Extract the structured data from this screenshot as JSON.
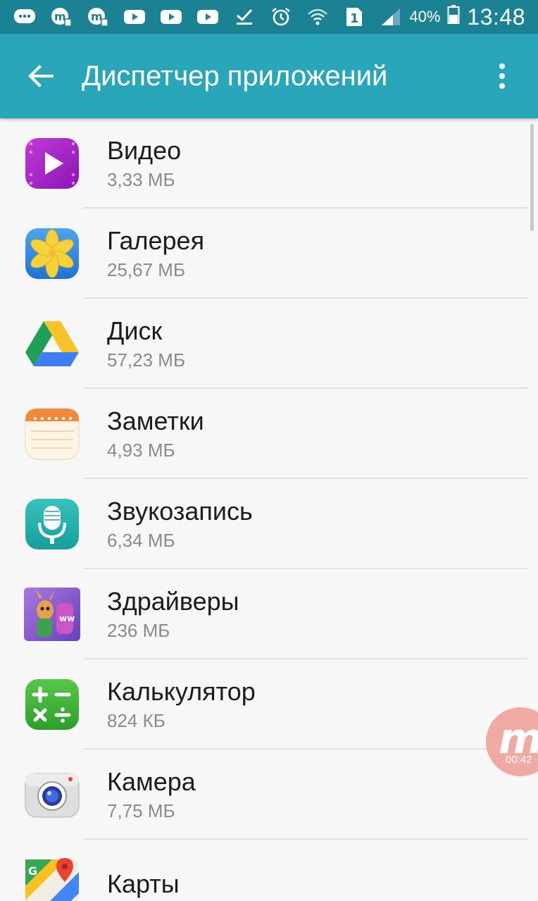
{
  "status_bar": {
    "icons": [
      "chat-bubble-icon",
      "app-m-icon",
      "app-m-icon",
      "youtube-icon",
      "youtube-icon",
      "youtube-icon",
      "download-done-icon",
      "alarm-icon",
      "wifi-icon",
      "sim-1-icon",
      "signal-icon"
    ],
    "battery_percent": "40%",
    "time": "13:48"
  },
  "app_bar": {
    "title": "Диспетчер приложений",
    "back_icon": "arrow-back-icon",
    "menu_icon": "more-vert-icon"
  },
  "apps": [
    {
      "name": "Видео",
      "size": "3,33 МБ",
      "icon": "video-app-icon"
    },
    {
      "name": "Галерея",
      "size": "25,67 МБ",
      "icon": "gallery-app-icon"
    },
    {
      "name": "Диск",
      "size": "57,23 МБ",
      "icon": "drive-app-icon"
    },
    {
      "name": "Заметки",
      "size": "4,93 МБ",
      "icon": "notes-app-icon"
    },
    {
      "name": "Звукозапись",
      "size": "6,34 МБ",
      "icon": "voice-recorder-app-icon"
    },
    {
      "name": "Здрайверы",
      "size": "236 МБ",
      "icon": "zdraivery-app-icon"
    },
    {
      "name": "Калькулятор",
      "size": "824 КБ",
      "icon": "calculator-app-icon"
    },
    {
      "name": "Камера",
      "size": "7,75 МБ",
      "icon": "camera-app-icon"
    },
    {
      "name": "Карты",
      "size": "",
      "icon": "maps-app-icon"
    }
  ],
  "recorder_bubble": {
    "letter": "m",
    "timer": "00:42"
  },
  "colors": {
    "status_bar": "#1b8294",
    "app_bar": "#2aa6bb",
    "background": "#f7f7f7"
  }
}
